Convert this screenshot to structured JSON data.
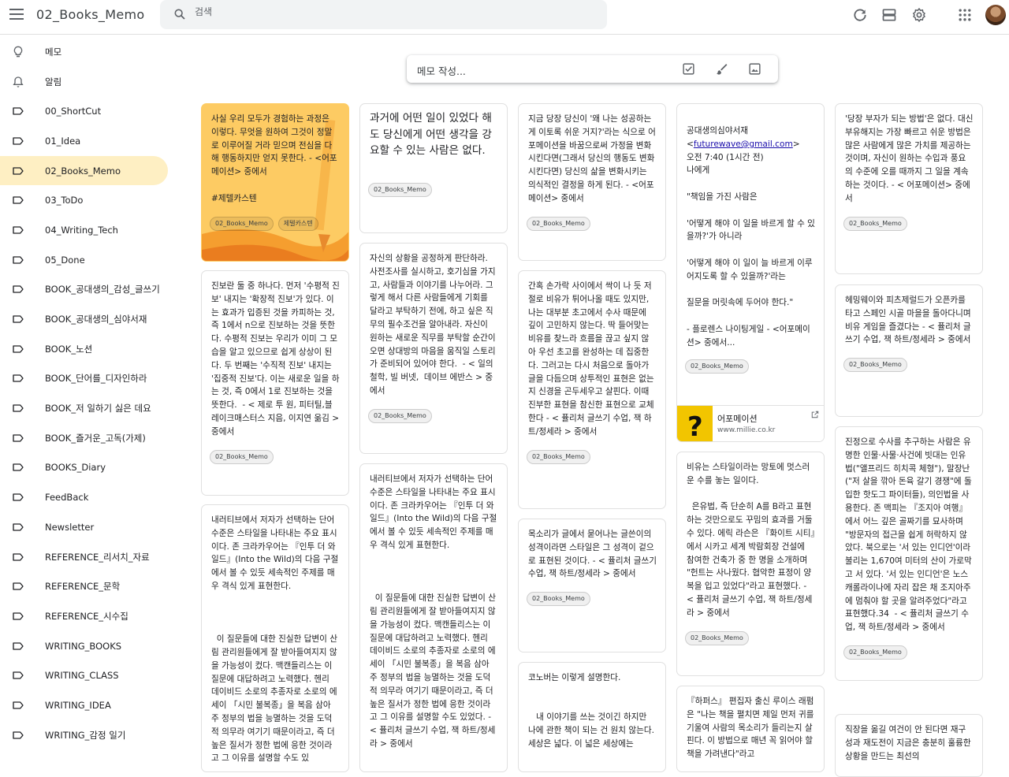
{
  "header": {
    "app_title": "02_Books_Memo",
    "search_placeholder": "검색"
  },
  "sidebar": {
    "items": [
      {
        "label": "메모",
        "icon": "lightbulb-icon"
      },
      {
        "label": "알림",
        "icon": "bell-icon"
      },
      {
        "label": "00_ShortCut",
        "icon": "label-icon"
      },
      {
        "label": "01_Idea",
        "icon": "label-icon"
      },
      {
        "label": "02_Books_Memo",
        "icon": "label-icon",
        "active": true
      },
      {
        "label": "03_ToDo",
        "icon": "label-icon"
      },
      {
        "label": "04_Writing_Tech",
        "icon": "label-icon"
      },
      {
        "label": "05_Done",
        "icon": "label-icon"
      },
      {
        "label": "BOOK_공대생의_감성_글쓰기",
        "icon": "label-icon"
      },
      {
        "label": "BOOK_공대생의_심야서재",
        "icon": "label-icon"
      },
      {
        "label": "BOOK_노션",
        "icon": "label-icon"
      },
      {
        "label": "BOOK_단어를_디자인하라",
        "icon": "label-icon"
      },
      {
        "label": "BOOK_저 일하기 싫은 데요",
        "icon": "label-icon"
      },
      {
        "label": "BOOK_즐거운_고독(가제)",
        "icon": "label-icon"
      },
      {
        "label": "BOOKS_Diary",
        "icon": "label-icon"
      },
      {
        "label": "FeedBack",
        "icon": "label-icon"
      },
      {
        "label": "Newsletter",
        "icon": "label-icon"
      },
      {
        "label": "REFERENCE_리서치_자료",
        "icon": "label-icon"
      },
      {
        "label": "REFERENCE_문학",
        "icon": "label-icon"
      },
      {
        "label": "REFERENCE_시수집",
        "icon": "label-icon"
      },
      {
        "label": "WRITING_BOOKS",
        "icon": "label-icon"
      },
      {
        "label": "WRITING_CLASS",
        "icon": "label-icon"
      },
      {
        "label": "WRITING_IDEA",
        "icon": "label-icon"
      },
      {
        "label": "WRITING_감정 일기",
        "icon": "label-icon"
      }
    ]
  },
  "composer": {
    "placeholder": "메모 작성..."
  },
  "colors": {
    "active_nav": "#feefc3",
    "yellow_note": "#fdcb63",
    "accent": "#1a73e8"
  },
  "notes": {
    "n1": {
      "text": "사실 우리 모두가 경험하는 과정은 이렇다. 무엇을 원하여 그것이 정말로 이루어질 거라 믿으며 전심을 다해 행동하지만 얻지 못한다. - <어포메이션> 중에서\n\n#제텔카스텐",
      "chips": [
        "02_Books_Memo",
        "제텔카스텐"
      ]
    },
    "n2": {
      "text": "진보란 둘 중 하나다. 먼저 '수평적 진보' 내지는 '확장적 진보'가 있다. 이는 효과가 입증된 것을 카피하는 것, 즉 1에서 n으로 진보하는 것을 뜻한다. 수평적 진보는 우리가 이미 그 모습을 알고 있으므로 쉽게 상상이 된다. 두 번째는 '수직적 진보' 내지는 '집중적 진보'다. 이는 새로운 일을 하는 것, 즉 0에서 1로 진보하는 것을 뜻한다.  - < 제로 투 원, 피터틸,블레이크매스터스 지음, 이지연 옮김 > 중에서",
      "chips": [
        "02_Books_Memo"
      ]
    },
    "n3": {
      "text": "내러티브에서 저자가 선택하는 단어 수준은 스타일을 나타내는 주요 표시이다. 존 크라카우어는 『인투 더 와일드』(Into the Wild)의 다음 구절에서 볼 수 있듯 세속적인 주제를 매우 격식 있게 표현한다.\n\n\n\n  이 질문들에 대한 진실한 답변이 산림 관리원들에게 잘 받아들여지지 않을 가능성이 컸다. 맥캔들리스는 이 질문에 대답하려고 노력했다. 헨리 데이비드 소로의 추종자로 소로의 에세이 「시민 불복종」을 복음 삼아 주 정부의 법을 능멸하는 것을 도덕적 의무라 여기기 때문이라고, 즉 더 높은 질서가 정한 법에 응한 것이라고 그 이유를 설명할 수도 있",
      "chips": []
    },
    "n4": {
      "title": "과거에 어떤 일이 있었다 해도 당신에게 어떤 생각을 강요할 수 있는 사람은 없다.",
      "chips": [
        "02_Books_Memo"
      ]
    },
    "n5": {
      "text": "자신의 상황을 공정하게 판단하라. 사전조사를 실시하고, 호기심을 가지고, 사람들과 이야기를 나누어라. 그렇게 해서 다른 사람들에게 기회를 달라고 부탁하기 전에, 하고 싶은 직무의 필수조건을 알아내라. 자신이 원하는 새로운 직무를 부탁할 순간이 오면 상대방의 마음을 움직일 스토리가 준비되어 있어야 한다.  - < 일의 철학, 빌 버넷,  데이브 에반스 > 중에서",
      "chips": [
        "02_Books_Memo"
      ]
    },
    "n6": {
      "text": "내러티브에서 저자가 선택하는 단어 수준은 스타일을 나타내는 주요 표시이다. 존 크라카우어는 『인투 더 와일드』(Into the Wild)의 다음 구절에서 볼 수 있듯 세속적인 주제를 매우 격식 있게 표현한다.\n\n\n\n  이 질문들에 대한 진실한 답변이 산림 관리원들에게 잘 받아들여지지 않을 가능성이 컸다. 맥캔들리스는 이 질문에 대답하려고 노력했다. 헨리 데이비드 소로의 추종자로 소로의 에세이 「시민 불복종」을 복음 삼아 주 정부의 법을 능멸하는 것을 도덕적 의무라 여기기 때문이라고, 즉 더 높은 질서가 정한 법에 응한 것이라고 그 이유를 설명할 수도 있었다. - < 퓰리처 글쓰기 수업, 잭 하트/정세라 > 중에서",
      "chips": []
    },
    "n7": {
      "text": "지금 당장 당신이 '왜 나는 성공하는 게 이토록 쉬운 거지?'라는 식으로 어포메이션을 바꿈으로써 가정을 변화시킨다면(그래서 당신의 행동도 변화시킨다면) 당신의 삶을 변화시키는 의식적인 결정을 하게 된다. - <어포메이션> 중에서",
      "chips": [
        "02_Books_Memo"
      ]
    },
    "n8": {
      "text": "간혹 손가락 사이에서 싹이 나 듯 저절로 비유가 튀어나올 때도 있지만, 나는 대부분 초고에서 수사 때문에 깊이 고민하지 않는다. 딱 들어맞는 비유를 찾느라 흐름을 끊고 싶지 않아 우선 초고를 완성하는 데 집중한다. 그러고는 다시 처음으로 돌아가 글을 다듬으며 상투적인 표현은 없는지 신경을 곤두세우고 살핀다. 이때 진부한 표현을 참신한 표현으로 교체한다 - < 퓰리처 글쓰기 수업, 잭 하트/정세라 > 중에서",
      "chips": [
        "02_Books_Memo"
      ]
    },
    "n9": {
      "text": "목소리가 글에서 묻어나는 글쓴이의 성격이라면 스타일은 그 성격이 겉으로 표현된 것이다. - < 퓰리처 글쓰기 수업, 잭 하트/정세라 > 중에서",
      "chips": [
        "02_Books_Memo"
      ]
    },
    "n10": {
      "text": "코노버는 이렇게 설명한다.\n\n\n   내 이야기를 쓰는 것이긴 하지만 나에 관한 책이 되는 건 원치 않는다. 세상은 넓다. 이 넓은 세상에는",
      "chips": []
    },
    "n11": {
      "text_before": "공대생의심야서재\n<",
      "email": "futurewave@gmail.com",
      "text_after": ">\n오전 7:40 (1시간 전)\n나에게\n\n\"책임을 가진 사람은\n\n'어떻게 해야 이 일을 바르게 할 수 있을까?'가 아니라\n\n'어떻게 해야 이 일이 늘 바르게 이루어지도록 할 수 있을까?'라는\n\n질문을 머릿속에 두어야 한다.\"\n\n- 플로렌스 나이팅게일 - <어포메이션> 중에서...",
      "chips": [
        "02_Books_Memo"
      ],
      "link": {
        "title": "어포메이션",
        "url": "www.millie.co.kr"
      }
    },
    "n12": {
      "text": "비유는 스타일이라는 망토에 멋스러운 수를 놓는 일이다.\n\n  은유법, 즉 단순히 A를 B라고 표현하는 것만으로도 꾸밈의 효과를 거둘 수 있다. 에릭 라슨은 『화이트 시티』에서 시카고 세계 박람회장 건설에 참여한 건축가 중 한 명을 소개하며 \"헌트는 사나웠다. 협악한 표정이 양복을 입고 있었다\"라고 표현했다. - < 퓰리처 글쓰기 수업, 잭 하트/정세라 > 중에서",
      "chips": [
        "02_Books_Memo"
      ]
    },
    "n13": {
      "text": "『하퍼스』 편집자 출신 루이스 래펌은 \"나는 책을 펼치면 제일 먼저 귀를 기울여 사람의 목소리가 들리는지 살핀다. 이 방법으로 매년 꼭 읽어야 할 책을 가려낸다\"라고",
      "chips": []
    },
    "n14": {
      "text": "'당장 부자가 되는 방법'은 없다. 대신 부유해지는 가장 빠르고 쉬운 방법은 많은 사람에게 많은 가치를 제공하는 것이며, 자신이 원하는 수입과 풍요의 수준에 오를 때까지 그 일을 계속하는 것이다. - < 어포메이션> 중에서",
      "chips": [
        "02_Books_Memo"
      ]
    },
    "n15": {
      "text": "헤밍웨이와 피츠제럴드가 오픈카를 타고 스페인 시골 마을을 돌아다니며 비유 게임을 즐겼다는 - < 퓰리처 글쓰기 수업, 잭 하트/정세라 > 중에서",
      "chips": [
        "02_Books_Memo"
      ]
    },
    "n16": {
      "text": "진정으로 수사를 추구하는 사람은 유명한 인물·사물·사건에 빗대는 인유법(\"앨프리드 히치콕 체형\"), 말장난(\"저 살을 깎아 돈육 갈기 경쟁\"에 돌입한 핫도그 파이터들), 의인법을 사용한다. 존 맥피는 『조지아 여행』에서 어느 깊은 골짜기를 묘사하며 \"방문자의 접근을 쉽게 허락하지 않았다. 북으로는 '서 있는 인디언'이라 불리는 1,670여 미터의 산이 가로막고 서 있다. '서 있는 인디언'은 노스캐롤라이나에 자리 잡은 채 조지아주에 멈춰야 할 곳을 알려주었다\"라고 표현했다.34  - < 퓰리처 글쓰기 수업, 잭 하트/정세라 > 중에서",
      "chips": [
        "02_Books_Memo"
      ]
    },
    "n17": {
      "text": "직장을 옮길 여건이 안 된다면 재구성과 재도전이 지금은 충분히 훌륭한 상황을 만드는 최선의",
      "chips": []
    }
  }
}
